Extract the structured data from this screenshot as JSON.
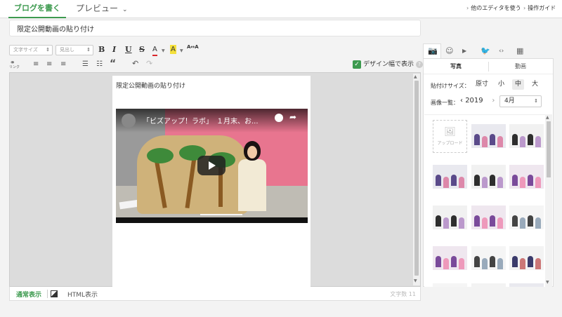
{
  "header": {
    "tab_write": "ブログを書く",
    "tab_preview": "プレビュー",
    "link_other_editor": "他のエディタを使う",
    "link_guide": "操作ガイド"
  },
  "title_input": {
    "value": "限定公開動画の貼り付け"
  },
  "toolbar": {
    "font_size_placeholder": "文字サイズ",
    "heading_placeholder": "見出し",
    "bold": "B",
    "italic": "I",
    "underline": "U",
    "strike": "S",
    "font_color": "A",
    "bg_color": "A",
    "size_toggle": "A↔A",
    "link_label": "リンク",
    "quote": "“",
    "design_width_label": "デザイン幅で表示",
    "design_width_checked": true
  },
  "editor": {
    "body_text": "限定公開動画の貼り付け",
    "video": {
      "title": "「ビズアップ！ラボ」　１月末、お..."
    }
  },
  "bottom_bar": {
    "mode_normal": "通常表示",
    "mode_html": "HTML表示",
    "char_count": "文字数 11"
  },
  "right_panel": {
    "tabs": {
      "photo": "写真",
      "video": "動画"
    },
    "paste_size_label": "貼付けサイズ：",
    "sizes": [
      "原寸",
      "小",
      "中",
      "大"
    ],
    "selected_size": "中",
    "image_list_label": "画像一覧：",
    "year": "2019",
    "month": "4月",
    "upload_label": "アップロード"
  },
  "colors": {
    "accent": "#3d9a4f",
    "video_wall": "#e8758f"
  }
}
